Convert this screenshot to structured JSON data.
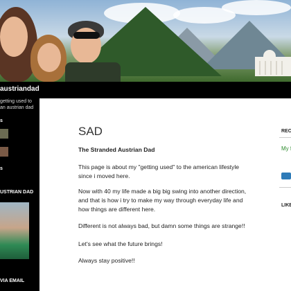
{
  "site": {
    "title": "austriandad",
    "description_lines": [
      "getting used to",
      "an austrian dad"
    ]
  },
  "sidebar": {
    "section_heads": [
      "s",
      "s",
      "USTRIAN DAD",
      "VIA EMAIL"
    ]
  },
  "page": {
    "title": "SAD",
    "paragraphs": [
      "The Stranded Austrian Dad",
      "This page is about my \"getting used\" to the american lifestyle since i moved here.",
      "Now with 40 my life made a big big swing into another direction, and that is how i try to make my way through everyday life and how things are different here.",
      "Different is not always bad, but damn some things are strange!!",
      "Let's see what the future brings!",
      "Always stay positive!!"
    ]
  },
  "rightbar": {
    "recent_head": "RECE",
    "recent_link": "My f",
    "likes_head": "LIKE"
  },
  "colors": {
    "link_green": "#2e8b2e",
    "badge_blue": "#2e7bb8"
  }
}
